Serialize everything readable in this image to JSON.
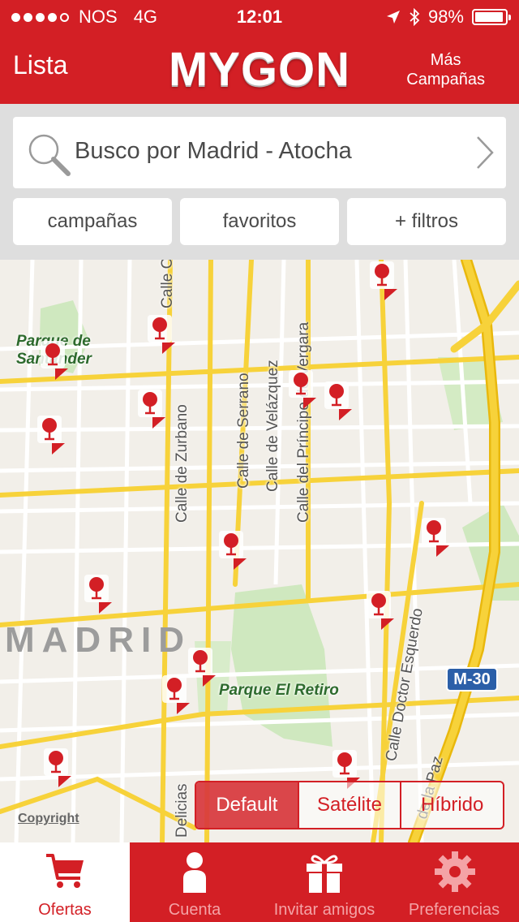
{
  "status": {
    "carrier": "NOS",
    "network": "4G",
    "time": "12:01",
    "battery": "98%"
  },
  "nav": {
    "left_label": "Lista",
    "logo": "MYGON",
    "right_label_1": "Más",
    "right_label_2": "Campañas"
  },
  "search": {
    "text": "Busco por Madrid - Atocha"
  },
  "filters": [
    "campañas",
    "favoritos",
    "+ filtros"
  ],
  "map": {
    "streets": [
      "Calle C",
      "Calle de Zurbano",
      "Calle de Serrano",
      "Calle de Velázquez",
      "Calle del Príncipe de Vergara",
      "Calle Doctor Esquerdo",
      "Delicias",
      "de la Paz"
    ],
    "parks": [
      "Parque de Santander",
      "Parque El Retiro"
    ],
    "city": "MADRID",
    "road_badge": "M-30",
    "copyright": "Copyright",
    "map_types": [
      "Default",
      "Satélite",
      "Híbrido"
    ],
    "active_map_type": "Default",
    "pin_icon": "wine-glass-icon"
  },
  "tabs": [
    "Ofertas",
    "Cuenta",
    "Invitar amigos",
    "Preferencias"
  ],
  "colors": {
    "brand": "#d31f25",
    "park": "#cfe8bf",
    "road_major": "#f7d23a",
    "background": "#f2efe9"
  }
}
